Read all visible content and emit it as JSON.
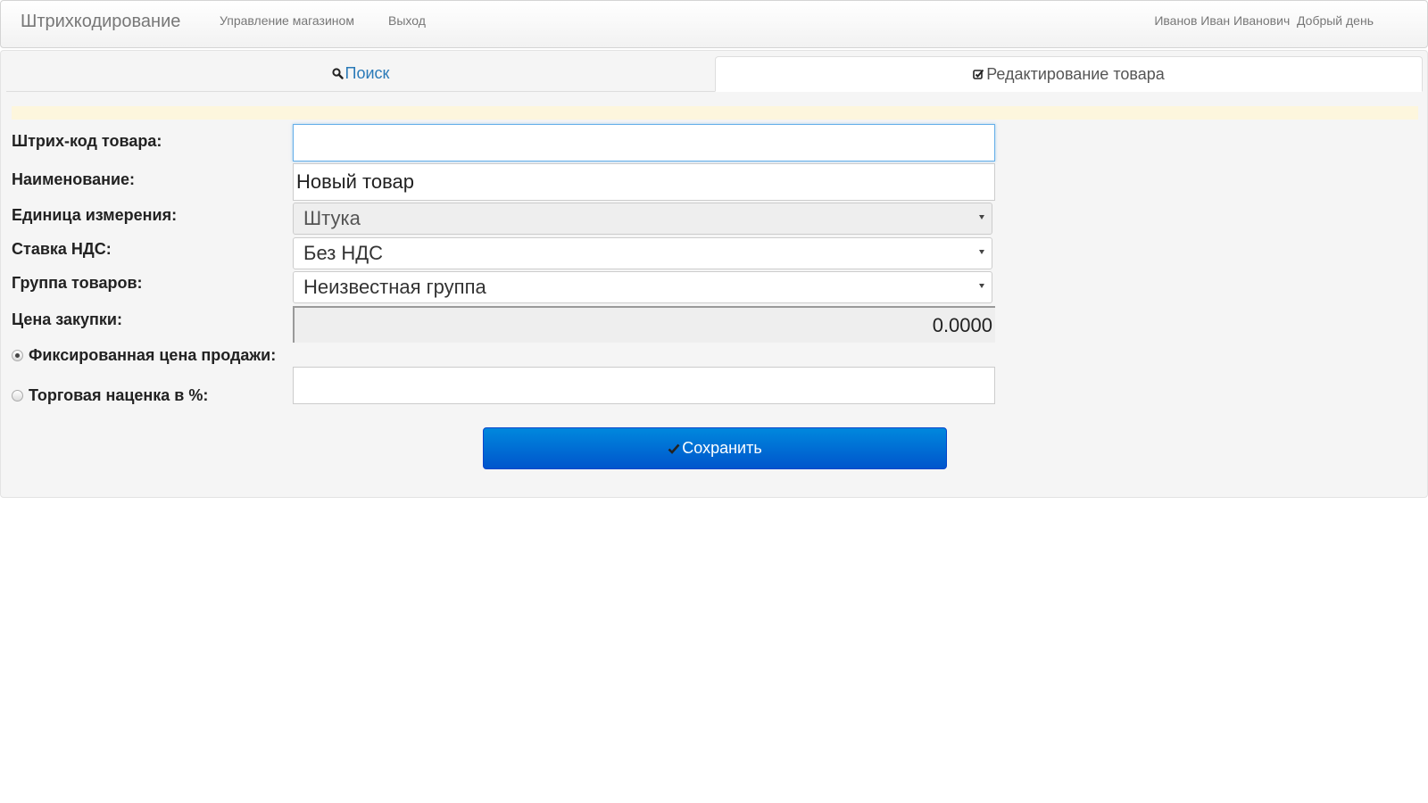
{
  "navbar": {
    "brand": "Штрихкодирование",
    "links": [
      "Управление магазином",
      "Выход"
    ],
    "user_name": "Иванов Иван Иванович",
    "greeting": "Добрый день"
  },
  "tabs": {
    "search_label": "Поиск",
    "edit_label": "Редактирование товара"
  },
  "form": {
    "barcode_label": "Штрих-код товара:",
    "barcode_value": "",
    "name_label": "Наименование:",
    "name_value": "Новый товар",
    "unit_label": "Единица измерения:",
    "unit_value": "Штука",
    "vat_label": "Ставка НДС:",
    "vat_value": "Без НДС",
    "group_label": "Группа товаров:",
    "group_value": "Неизвестная группа",
    "purchase_price_label": "Цена закупки:",
    "purchase_price_value": "0.0000",
    "fixed_price_label": "Фиксированная цена продажи:",
    "markup_label": "Торговая наценка в %:",
    "price_value": ""
  },
  "save_label": "Сохранить",
  "colors": {
    "accent": "#2a7ab8",
    "button": "#0066d6",
    "warning": "#fdf6dd"
  }
}
